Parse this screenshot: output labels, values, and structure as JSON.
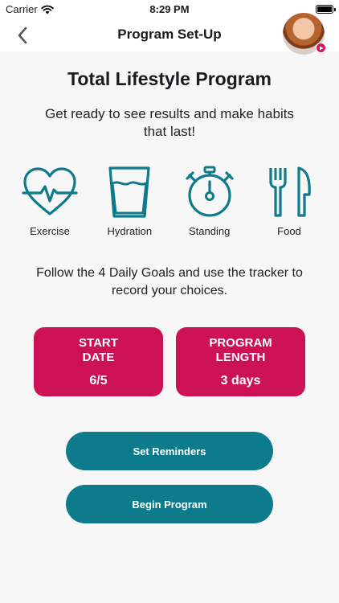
{
  "status_bar": {
    "carrier": "Carrier",
    "time": "8:29 PM",
    "wifi_icon": "wifi-icon",
    "battery_icon": "battery-icon"
  },
  "nav": {
    "title": "Program Set-Up",
    "back_icon": "chevron-left-icon"
  },
  "main": {
    "title": "Total Lifestyle Program",
    "intro": "Get ready to see results and make habits that last!",
    "goals": [
      {
        "label": "Exercise",
        "icon": "heart-pulse-icon"
      },
      {
        "label": "Hydration",
        "icon": "glass-icon"
      },
      {
        "label": "Standing",
        "icon": "stopwatch-icon"
      },
      {
        "label": "Food",
        "icon": "fork-knife-icon"
      }
    ],
    "follow_text": "Follow the 4 Daily Goals and use the tracker to record your choices.",
    "cards": {
      "start": {
        "heading": "START DATE",
        "value": "6/5"
      },
      "length": {
        "heading": "PROGRAM LENGTH",
        "value": "3 days"
      }
    },
    "buttons": {
      "reminders": "Set Reminders",
      "begin": "Begin Program"
    }
  },
  "colors": {
    "accent_teal": "#0d7b8c",
    "accent_pink": "#cc1155",
    "background": "#f7f7f8"
  }
}
